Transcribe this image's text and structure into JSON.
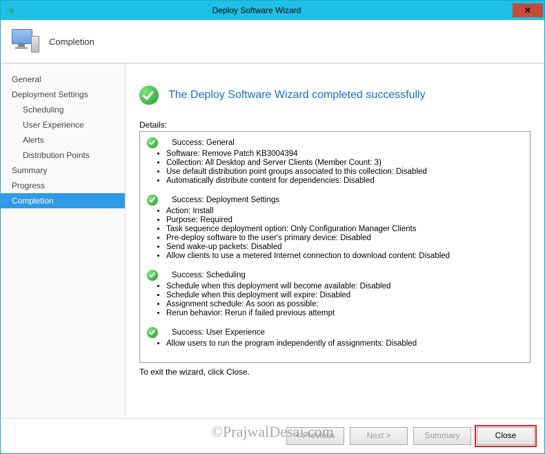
{
  "window": {
    "title": "Deploy Software Wizard"
  },
  "header": {
    "page": "Completion"
  },
  "sidebar": {
    "items": [
      {
        "label": "General",
        "sub": false
      },
      {
        "label": "Deployment Settings",
        "sub": false
      },
      {
        "label": "Scheduling",
        "sub": true
      },
      {
        "label": "User Experience",
        "sub": true
      },
      {
        "label": "Alerts",
        "sub": true
      },
      {
        "label": "Distribution Points",
        "sub": true
      },
      {
        "label": "Summary",
        "sub": false
      },
      {
        "label": "Progress",
        "sub": false
      },
      {
        "label": "Completion",
        "sub": false,
        "active": true
      }
    ]
  },
  "main": {
    "heading": "The Deploy Software Wizard completed successfully",
    "details_label": "Details:",
    "exit_text": "To exit the wizard, click Close.",
    "sections": [
      {
        "title": "Success: General",
        "items": [
          "Software: Remove Patch KB3004394",
          "Collection: All Desktop and Server Clients (Member Count: 3)",
          "Use default distribution point groups associated to this collection: Disabled",
          "Automatically distribute content for dependencies: Disabled"
        ]
      },
      {
        "title": "Success: Deployment Settings",
        "items": [
          "Action: Install",
          "Purpose: Required",
          "Task sequence deployment option: Only Configuration Manager Clients",
          "Pre-deploy software to the user's primary device: Disabled",
          "Send wake-up packets: Disabled",
          "Allow clients to use a metered Internet connection to download content: Disabled"
        ]
      },
      {
        "title": "Success: Scheduling",
        "items": [
          "Schedule when this deployment will become available: Disabled",
          "Schedule when this deployment will expire: Disabled",
          "Assignment schedule: As soon as possible;",
          "Rerun behavior: Rerun if failed previous attempt"
        ]
      },
      {
        "title": "Success: User Experience",
        "items": [
          "Allow users to run the program independently of assignments: Disabled"
        ]
      }
    ]
  },
  "footer": {
    "previous": "< Previous",
    "next": "Next >",
    "summary": "Summary",
    "close": "Close"
  },
  "watermark": "©PrajwalDesai.com"
}
